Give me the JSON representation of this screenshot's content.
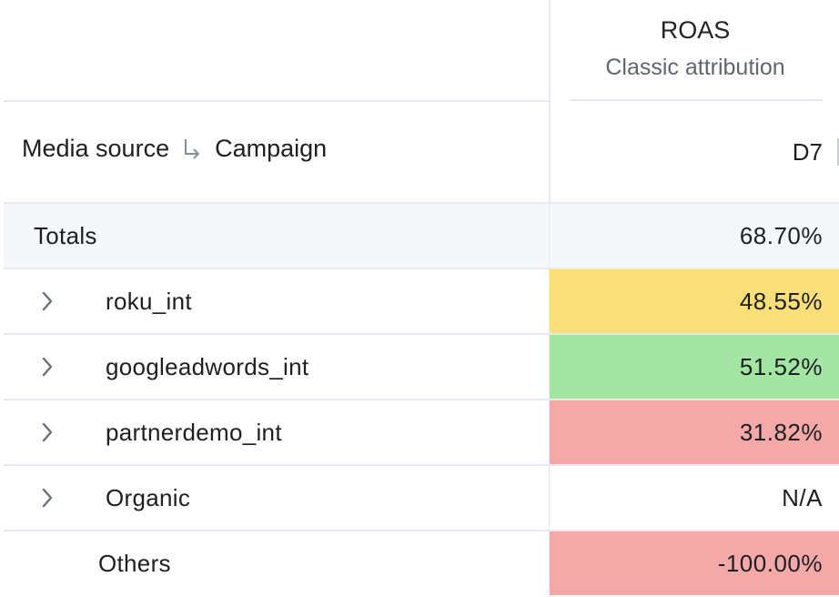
{
  "metric": {
    "title": "ROAS",
    "subtitle": "Classic attribution"
  },
  "header": {
    "dimension_primary": "Media source",
    "dimension_secondary": "Campaign",
    "period": "D7"
  },
  "colors": {
    "yellow": "#f8df79",
    "green": "#a3e6a3",
    "red": "#f4a9a8",
    "none": "#ffffff",
    "totals_bg": "#f5f7fa"
  },
  "rows": [
    {
      "label": "Totals",
      "value": "68.70%",
      "expandable": false,
      "color": "totals",
      "kind": "totals"
    },
    {
      "label": "roku_int",
      "value": "48.55%",
      "expandable": true,
      "color": "yellow",
      "kind": "row"
    },
    {
      "label": "googleadwords_int",
      "value": "51.52%",
      "expandable": true,
      "color": "green",
      "kind": "row"
    },
    {
      "label": "partnerdemo_int",
      "value": "31.82%",
      "expandable": true,
      "color": "red",
      "kind": "row"
    },
    {
      "label": "Organic",
      "value": "N/A",
      "expandable": true,
      "color": "none",
      "kind": "row"
    },
    {
      "label": "Others",
      "value": "-100.00%",
      "expandable": false,
      "color": "red",
      "kind": "row"
    }
  ]
}
